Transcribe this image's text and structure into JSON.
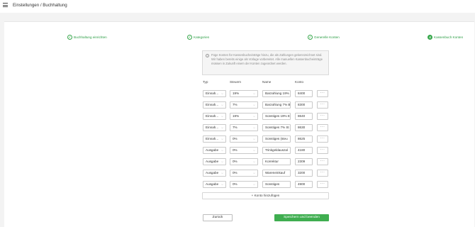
{
  "header": {
    "breadcrumb": "Einstellungen / Buchhaltung",
    "menu_icon": "hamburger-menu-icon"
  },
  "stepper": {
    "steps": [
      {
        "label": "Buchhaltung einrichten",
        "state": "done",
        "icon": "check-circle-icon"
      },
      {
        "label": "Kategorien",
        "state": "done",
        "icon": "check-circle-icon"
      },
      {
        "label": "Generelle Konten",
        "state": "done",
        "icon": "check-circle-icon"
      },
      {
        "label": "Kassenbuch Konten",
        "state": "active",
        "number": "4"
      }
    ],
    "accent_color": "#3fae50"
  },
  "info": {
    "icon": "info-icon",
    "text": "Füge Konten für Kassenbucheinträge hinzu, die als Zahlungen gekennzeichnet sind. Wir haben bereits einige als Vorlage vorbereitet. Alle manuellen Kassenbucheinträge müssen in Zukunft einem der Konten zugeordnet werden."
  },
  "table": {
    "headers": {
      "typ": "Typ",
      "steuern": "Steuern",
      "name": "Name",
      "konto": "Konto"
    },
    "rows": [
      {
        "typ": "Einnah...",
        "steuern": "19%",
        "name": "Barzahlung 19%",
        "konto": "8400",
        "more": "···"
      },
      {
        "typ": "Einnah...",
        "steuern": "7%",
        "name": "Barzahlung 7% B",
        "konto": "8300",
        "more": "···"
      },
      {
        "typ": "Einnah...",
        "steuern": "19%",
        "name": "Sonstiges 19% Ei",
        "konto": "8640",
        "more": "···"
      },
      {
        "typ": "Einnah...",
        "steuern": "7%",
        "name": "Sonstiges 7% St",
        "konto": "8630",
        "more": "···"
      },
      {
        "typ": "Einnah...",
        "steuern": "0%",
        "name": "Sonstiges (steu",
        "konto": "8625",
        "more": "···"
      },
      {
        "typ": "Ausgabe",
        "steuern": "0%",
        "name": "Trinkgeldauszal",
        "konto": "4180",
        "more": "···"
      },
      {
        "typ": "Ausgabe",
        "steuern": "0%",
        "name": "Korrektur",
        "konto": "2309",
        "more": "···"
      },
      {
        "typ": "Ausgabe",
        "steuern": "0%",
        "name": "Wareneinkauf",
        "konto": "3200",
        "more": "···"
      },
      {
        "typ": "Ausgabe",
        "steuern": "0%",
        "name": "Sonstiges",
        "konto": "4900",
        "more": "···"
      }
    ]
  },
  "actions": {
    "add_account": "+ Konto hinzufügen",
    "back": "Zurück",
    "save_continue": "Speichern und beenden"
  }
}
